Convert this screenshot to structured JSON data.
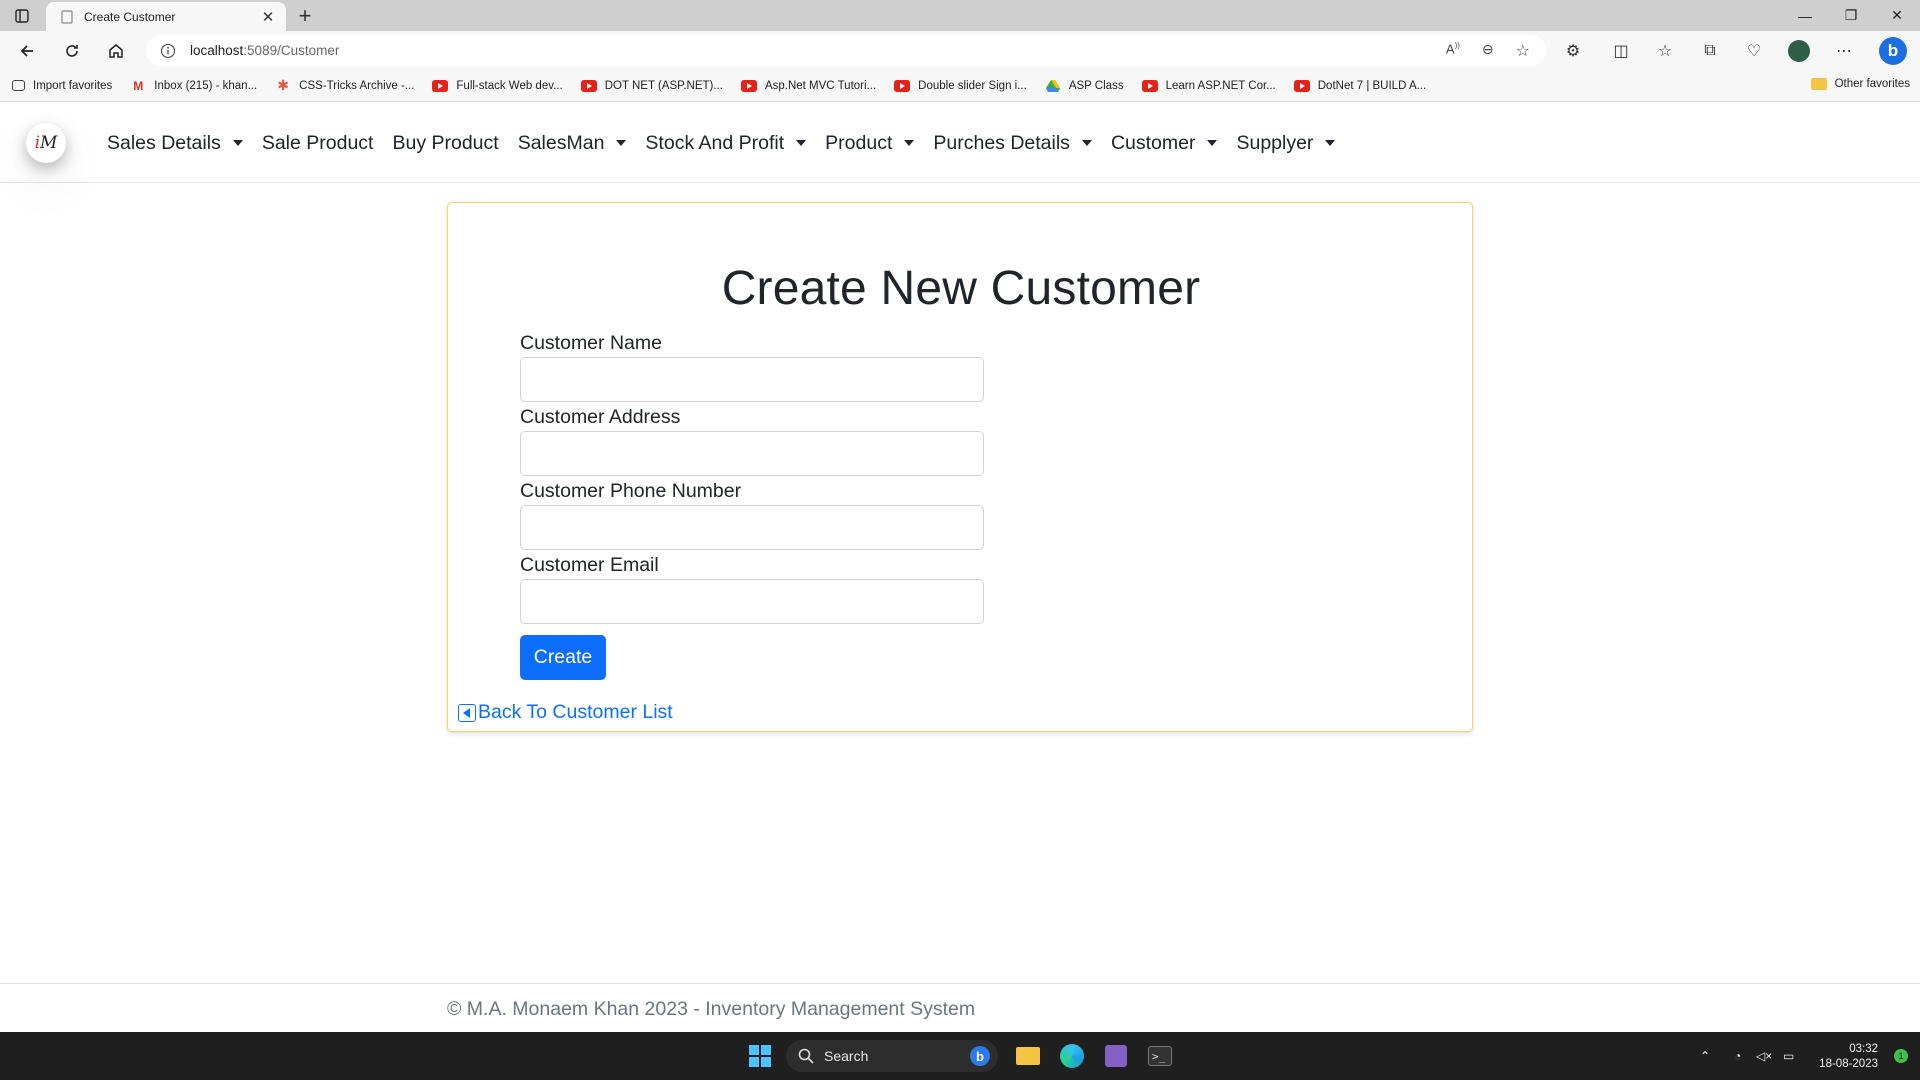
{
  "browser": {
    "tab_title": "Create Customer",
    "url_host": "localhost",
    "url_path": ":5089/Customer",
    "favorites": [
      {
        "label": "Import favorites",
        "icon": "import-icon"
      },
      {
        "label": "Inbox (215) - khan...",
        "icon": "gmail-icon"
      },
      {
        "label": "CSS-Tricks Archive -...",
        "icon": "css-tricks-icon"
      },
      {
        "label": "Full-stack Web dev...",
        "icon": "youtube-icon"
      },
      {
        "label": "DOT NET (ASP.NET)...",
        "icon": "youtube-icon"
      },
      {
        "label": "Asp.Net MVC Tutori...",
        "icon": "youtube-icon"
      },
      {
        "label": "Double slider Sign i...",
        "icon": "youtube-icon"
      },
      {
        "label": "ASP Class",
        "icon": "google-drive-icon"
      },
      {
        "label": "Learn ASP.NET Cor...",
        "icon": "youtube-icon"
      },
      {
        "label": "DotNet 7 | BUILD A...",
        "icon": "youtube-icon"
      }
    ],
    "other_favorites": "Other favorites"
  },
  "nav": {
    "logo_text": "M",
    "items": [
      {
        "label": "Sales Details",
        "dropdown": true
      },
      {
        "label": "Sale Product",
        "dropdown": false
      },
      {
        "label": "Buy Product",
        "dropdown": false
      },
      {
        "label": "SalesMan",
        "dropdown": true
      },
      {
        "label": "Stock And Profit",
        "dropdown": true
      },
      {
        "label": "Product",
        "dropdown": true
      },
      {
        "label": "Purches Details",
        "dropdown": true
      },
      {
        "label": "Customer",
        "dropdown": true
      },
      {
        "label": "Supplyer",
        "dropdown": true
      }
    ]
  },
  "form": {
    "title": "Create New Customer",
    "fields": [
      {
        "label": "Customer Name",
        "value": ""
      },
      {
        "label": "Customer Address",
        "value": ""
      },
      {
        "label": "Customer Phone Number",
        "value": ""
      },
      {
        "label": "Customer Email",
        "value": ""
      }
    ],
    "submit_label": "Create",
    "back_link": "Back To Customer List"
  },
  "footer": {
    "text": "© M.A. Monaem Khan 2023 - Inventory Management System"
  },
  "taskbar": {
    "search_label": "Search",
    "time": "03:32",
    "date": "18-08-2023",
    "notification_count": "1"
  },
  "colors": {
    "primary": "#0d6efd",
    "card_border": "#f0d56a",
    "footer_text": "#6c757d"
  }
}
